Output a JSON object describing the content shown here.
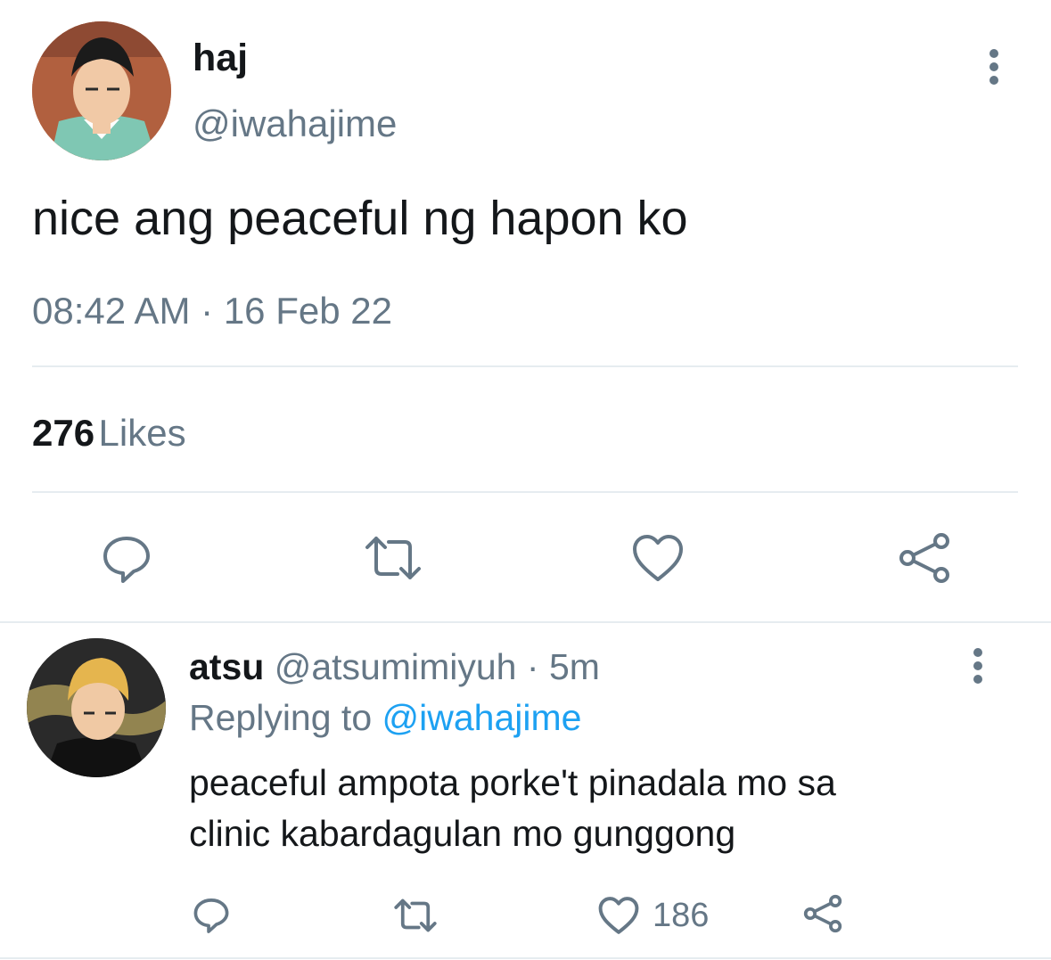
{
  "tweet": {
    "author_name": "haj",
    "author_handle": "@iwahajime",
    "text": "nice ang peaceful ng hapon ko",
    "time": "08:42 AM",
    "separator": "·",
    "date": "16 Feb 22",
    "likes_count": "276",
    "likes_label": "Likes",
    "more_icon": "more-vertical-icon",
    "actions": [
      "reply-icon",
      "retweet-icon",
      "like-icon",
      "share-icon"
    ]
  },
  "reply": {
    "author_name": "atsu",
    "author_handle": "@atsumimiyuh",
    "separator": "·",
    "age": "5m",
    "replying_prefix": "Replying to",
    "replying_to": "@iwahajime",
    "text_line1": "peaceful ampota porke't pinadala mo sa",
    "text_line2": "clinic kabardagulan mo gunggong",
    "like_count": "186",
    "more_icon": "more-vertical-icon",
    "actions": [
      "reply-icon",
      "retweet-icon",
      "like-icon",
      "share-icon"
    ]
  },
  "colors": {
    "text_primary": "#14171a",
    "text_secondary": "#657786",
    "link": "#1da1f2",
    "divider": "#e6ecf0"
  }
}
